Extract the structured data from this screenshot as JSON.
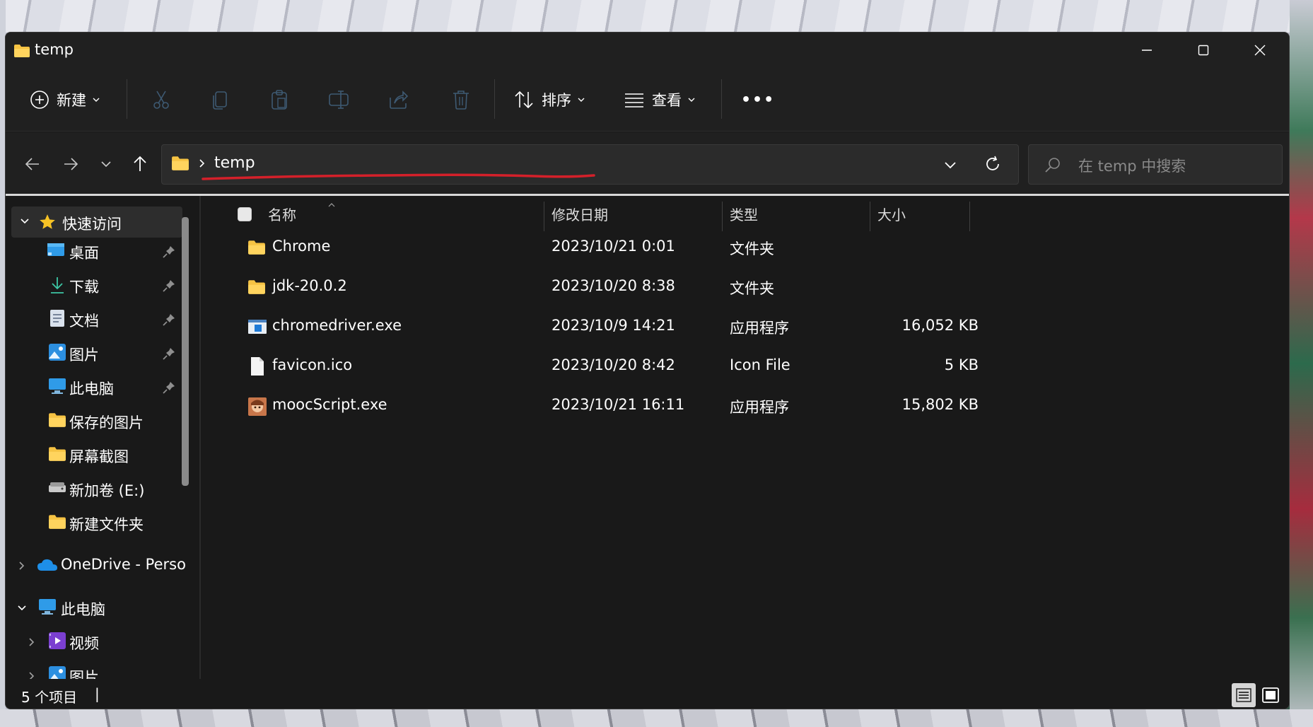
{
  "window": {
    "title": "temp"
  },
  "toolbar": {
    "new_label": "新建",
    "sort_label": "排序",
    "view_label": "查看",
    "more_label": "•••"
  },
  "address": {
    "path_item": "temp",
    "search_placeholder": "在 temp 中搜索"
  },
  "sidebar": {
    "quick_access": "快速访问",
    "items": [
      {
        "label": "桌面",
        "icon": "desktop-icon"
      },
      {
        "label": "下载",
        "icon": "download-icon"
      },
      {
        "label": "文档",
        "icon": "document-icon"
      },
      {
        "label": "图片",
        "icon": "pictures-icon"
      },
      {
        "label": "此电脑",
        "icon": "computer-icon"
      },
      {
        "label": "保存的图片",
        "icon": "folder-icon"
      },
      {
        "label": "屏幕截图",
        "icon": "folder-icon"
      },
      {
        "label": "新加卷 (E:)",
        "icon": "drive-icon"
      },
      {
        "label": "新建文件夹",
        "icon": "folder-icon"
      }
    ],
    "onedrive": "OneDrive - Perso",
    "this_pc": "此电脑",
    "pc_items": [
      {
        "label": "视频",
        "icon": "video-icon"
      },
      {
        "label": "图片",
        "icon": "pictures-icon"
      }
    ]
  },
  "columns": {
    "name": "名称",
    "modified": "修改日期",
    "type": "类型",
    "size": "大小"
  },
  "files": [
    {
      "name": "Chrome",
      "modified": "2023/10/21 0:01",
      "type": "文件夹",
      "size": "",
      "icon": "folder-icon"
    },
    {
      "name": "jdk-20.0.2",
      "modified": "2023/10/20 8:38",
      "type": "文件夹",
      "size": "",
      "icon": "folder-icon"
    },
    {
      "name": "chromedriver.exe",
      "modified": "2023/10/9 14:21",
      "type": "应用程序",
      "size": "16,052 KB",
      "icon": "app-icon"
    },
    {
      "name": "favicon.ico",
      "modified": "2023/10/20 8:42",
      "type": "Icon File",
      "size": "5 KB",
      "icon": "file-icon"
    },
    {
      "name": "moocScript.exe",
      "modified": "2023/10/21 16:11",
      "type": "应用程序",
      "size": "15,802 KB",
      "icon": "app-avatar-icon"
    }
  ],
  "status": {
    "item_count": "5 个项目",
    "cursor": "|"
  },
  "colors": {
    "folder": "#f6c343",
    "accent_underline": "#d4202a",
    "bg": "#191919",
    "panel": "#202020"
  }
}
